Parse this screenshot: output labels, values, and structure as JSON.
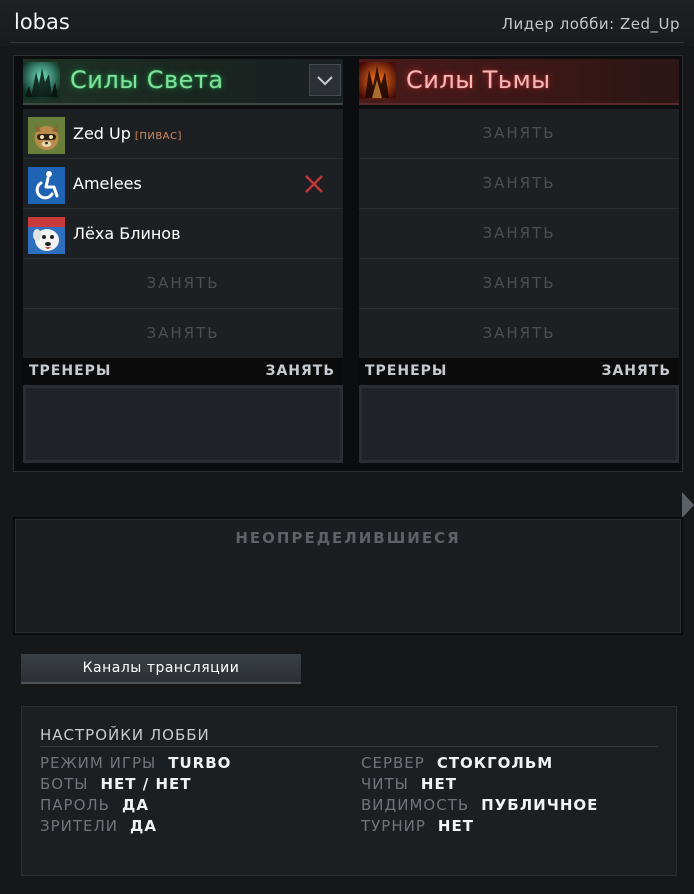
{
  "header": {
    "lobby_name": "lobas",
    "leader_label": "Лидер лобби: Zed_Up"
  },
  "radiant": {
    "title": "Силы Света",
    "icon": "radiant-icon",
    "accent": "#7ee29a",
    "players": [
      {
        "name": "Zed Up",
        "tag": "[ПИВАС]",
        "avatar": "raccoon-avatar"
      },
      {
        "name": "Amelees",
        "tag": "",
        "avatar": "wheelchair-avatar",
        "kick": true
      },
      {
        "name": "Лёха Блинов",
        "tag": "",
        "avatar": "dog-avatar"
      }
    ],
    "empty_slot_label": "ЗАНЯТЬ",
    "coach_label": "ТРЕНЕРЫ",
    "coach_take": "ЗАНЯТЬ"
  },
  "dire": {
    "title": "Силы Тьмы",
    "icon": "dire-icon",
    "accent": "#f3b9b9",
    "empty_slot_label": "ЗАНЯТЬ",
    "coach_label": "ТРЕНЕРЫ",
    "coach_take": "ЗАНЯТЬ"
  },
  "unassigned": {
    "title": "НЕОПРЕДЕЛИВШИЕСЯ"
  },
  "broadcast_button": "Каналы трансляции",
  "settings": {
    "title": "НАСТРОЙКИ ЛОББИ",
    "left": [
      {
        "key": "РЕЖИМ ИГРЫ",
        "value": "TURBO"
      },
      {
        "key": "БОТЫ",
        "value": "НЕТ / НЕТ"
      },
      {
        "key": "ПАРОЛЬ",
        "value": "ДА"
      },
      {
        "key": "ЗРИТЕЛИ",
        "value": "ДА"
      }
    ],
    "right": [
      {
        "key": "СЕРВЕР",
        "value": "СТОКГОЛЬМ"
      },
      {
        "key": "ЧИТЫ",
        "value": "НЕТ"
      },
      {
        "key": "ВИДИМОСТЬ",
        "value": "ПУБЛИЧНОЕ"
      },
      {
        "key": "ТУРНИР",
        "value": "НЕТ"
      }
    ]
  }
}
